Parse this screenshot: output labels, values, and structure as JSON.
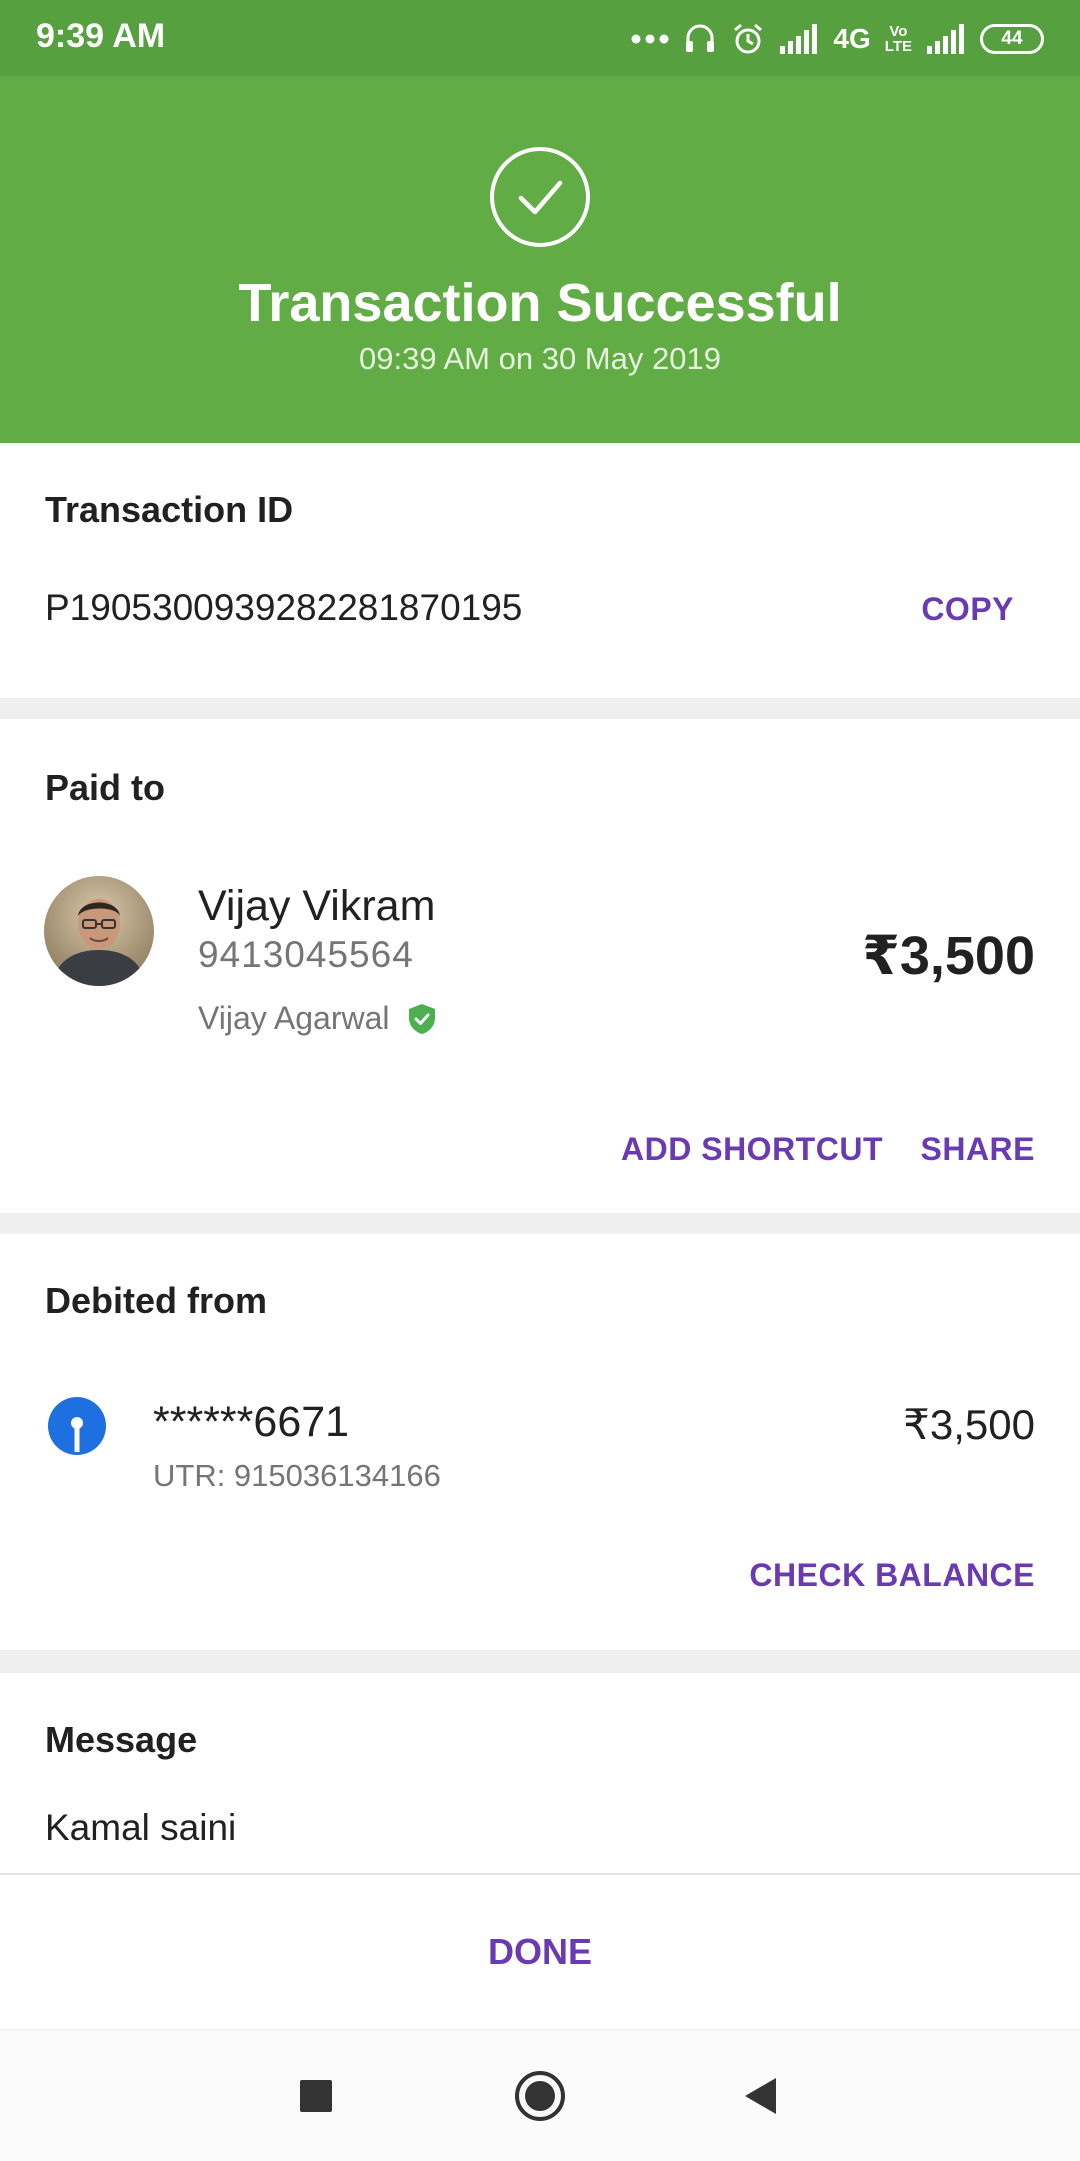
{
  "status_bar": {
    "time": "9:39 AM",
    "network": "4G",
    "volte_top": "Vo",
    "volte_bottom": "LTE",
    "battery": "44",
    "icons": [
      "more-dots-icon",
      "headset-icon",
      "alarm-icon",
      "signal-icon",
      "signal-icon"
    ]
  },
  "banner": {
    "title": "Transaction Successful",
    "subtitle": "09:39 AM on 30 May 2019",
    "icon": "check-circle-icon",
    "color": "#62ac45"
  },
  "transaction": {
    "label": "Transaction ID",
    "id": "P1905300939282281870195",
    "copy_label": "COPY"
  },
  "paid_to": {
    "label": "Paid to",
    "name": "Vijay Vikram",
    "phone": "9413045564",
    "bank_name": "Vijay Agarwal",
    "amount": "₹3,500",
    "add_shortcut_label": "ADD SHORTCUT",
    "share_label": "SHARE"
  },
  "debited_from": {
    "label": "Debited from",
    "account": "******6671",
    "utr": "UTR: 915036134166",
    "amount": "₹3,500",
    "check_balance_label": "CHECK BALANCE"
  },
  "message": {
    "label": "Message",
    "text": "Kamal saini"
  },
  "done_label": "DONE",
  "colors": {
    "accent": "#6a3ab2",
    "success": "#62ac45",
    "status_bar": "#56a03f",
    "verified": "#4caf50",
    "bank": "#1e6fe0"
  }
}
